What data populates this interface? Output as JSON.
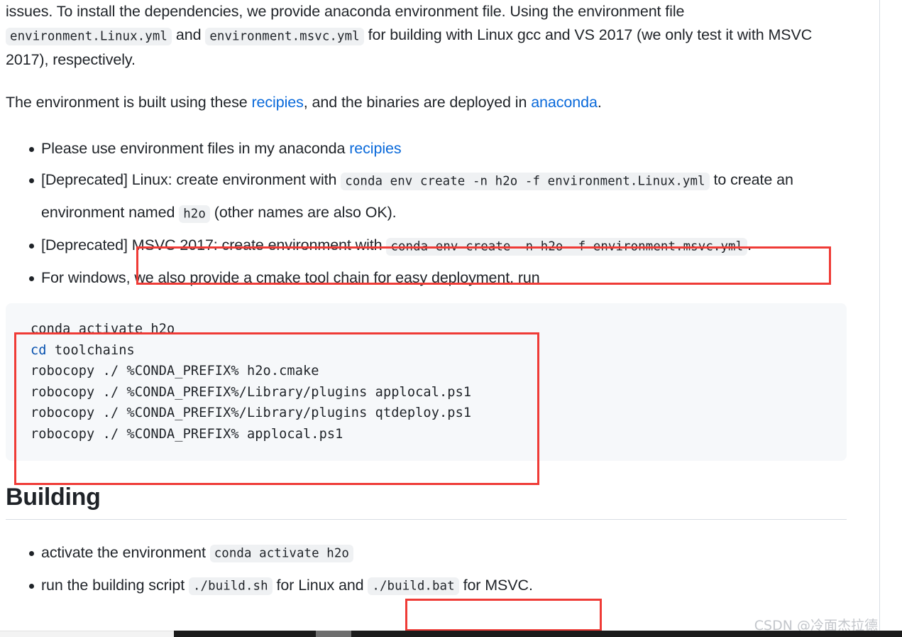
{
  "document": {
    "intro_paragraph": {
      "segment_1": "issues. To install the dependencies, we provide anaconda environment file. Using the environment file",
      "code_1": "environment.Linux.yml",
      "segment_2": "and",
      "code_2": "environment.msvc.yml",
      "segment_3": "for building with Linux gcc and VS 2017 (we only test it with MSVC 2017), respectively."
    },
    "env_paragraph": {
      "segment_1": "The environment is built using these",
      "link_1": "recipies",
      "segment_2": ", and the binaries are deployed in",
      "link_2": "anaconda",
      "segment_3": "."
    },
    "bullets": [
      {
        "segment_1": "Please use environment files in my anaconda",
        "link_1": "recipies"
      },
      {
        "segment_1": "[Deprecated] Linux: create environment with",
        "code_1": "conda env create -n h2o -f environment.Linux.yml",
        "segment_2": "to create an environment named",
        "code_2": "h2o",
        "segment_3": "(other names are also OK)."
      },
      {
        "segment_1": "[Deprecated]",
        "segment_2": "MSVC 2017: create environment with",
        "code_1": "conda env create -n h2o -f environment.msvc.yml",
        "segment_3": "."
      },
      {
        "segment_1": "For windows, we also provide a cmake tool chain for easy deployment, run"
      }
    ],
    "code_block": {
      "lines": [
        {
          "keyword": "",
          "text": "conda activate h2o"
        },
        {
          "keyword": "cd",
          "text": " toolchains"
        },
        {
          "keyword": "",
          "text": "robocopy ./ %CONDA_PREFIX% h2o.cmake"
        },
        {
          "keyword": "",
          "text": "robocopy ./ %CONDA_PREFIX%/Library/plugins applocal.ps1"
        },
        {
          "keyword": "",
          "text": "robocopy ./ %CONDA_PREFIX%/Library/plugins qtdeploy.ps1"
        },
        {
          "keyword": "",
          "text": "robocopy ./ %CONDA_PREFIX% applocal.ps1"
        }
      ]
    },
    "building_section": {
      "heading": "Building",
      "bullets": [
        {
          "segment_1": "activate the environment",
          "code_1": "conda activate h2o"
        },
        {
          "segment_1": "run the building script",
          "code_1": "./build.sh",
          "segment_2": "for Linux and",
          "code_2": "./build.bat",
          "segment_3": "for MSVC."
        }
      ]
    }
  },
  "annotations": {
    "highlight_color": "#ef3b36",
    "boxes": [
      {
        "name": "msvc-environment-line"
      },
      {
        "name": "toolchain-code-block"
      },
      {
        "name": "build-bat-phrase"
      }
    ]
  },
  "watermark": {
    "text": "CSDN @冷面杰拉德"
  },
  "colors": {
    "link": "#0969da",
    "code_bg": "#eff1f3",
    "codeblock_bg": "#f6f8fa",
    "text": "#1f2328",
    "rule": "#d8dee4",
    "keyword": "#0550ae"
  },
  "scrollbar": {
    "orientation": "horizontal",
    "track_color": "#1b1b1b",
    "thumb_color": "#6e6e6e"
  }
}
